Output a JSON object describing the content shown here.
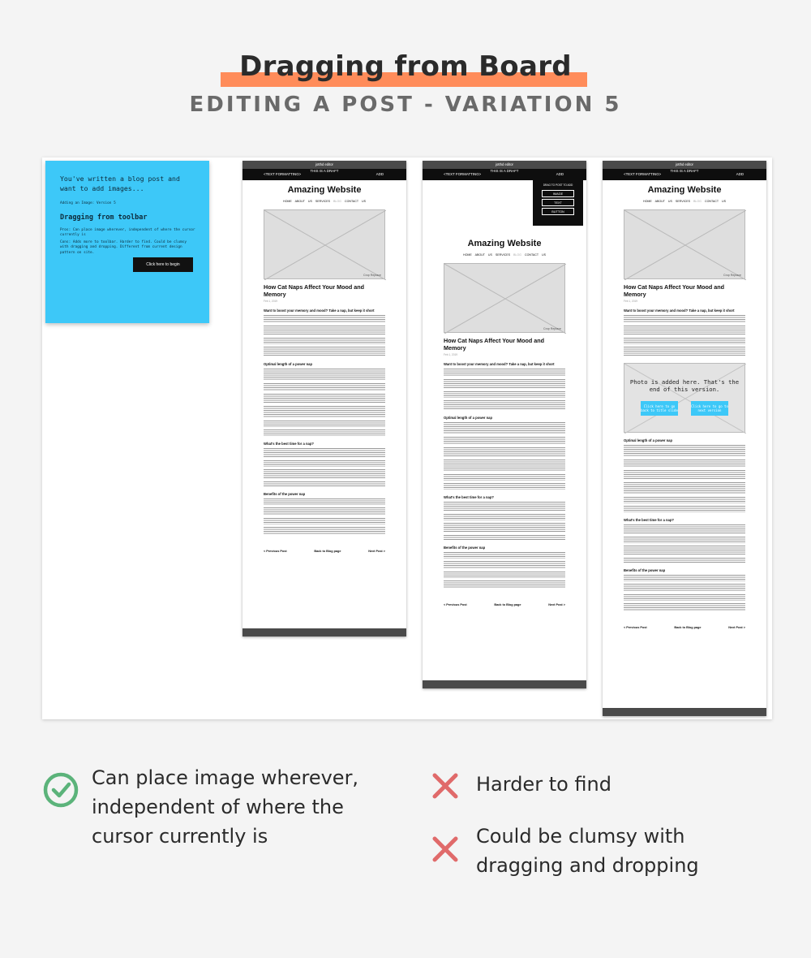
{
  "header": {
    "title": "Dragging from Board",
    "subtitle": "EDITING A POST - VARIATION 5"
  },
  "card": {
    "question": "You've written a blog post and want to add images...",
    "small_label": "Adding an Image: Version 5",
    "heading": "Dragging from toolbar",
    "pros_text": "Pros: Can place image wherever, independent of where the cursor currently is",
    "cons_text": "Cons: Adds more to toolbar. Harder to find. Could be clumsy with dragging and dropping. Different from current design pattern on site.",
    "button": "Click here to begin"
  },
  "editor": {
    "app_name": "jotthd editor",
    "draft_label": "THIS IS A DRAFT",
    "text_formatting": "<TEXT FORMATTING>",
    "add": "ADD",
    "site_title": "Amazing Website",
    "nav": [
      "HOME",
      "ABOUT US",
      "SERVICES",
      "BLOG",
      "CONTACT US"
    ],
    "image_caption": "Crop  Replace",
    "post_title": "How Cat Naps Affect Your Mood and Memory",
    "post_date": "Feb 1, 2019",
    "sections": [
      "Want to boost your memory and mood? Take a nap, but keep it short",
      "Optimal length of a power nap",
      "What's the best time for a nap?",
      "Benefits of the power nap"
    ],
    "footer_nav": [
      "< Previous Post",
      "Back to Blog page",
      "Next Post >"
    ]
  },
  "drag_menu": {
    "title": "DRAG TO POST TO ADD",
    "options": [
      "IMAGE",
      "TEXT",
      "BUTTON"
    ]
  },
  "photo_added": {
    "message": "Photo is added here. That's the end of this version.",
    "button_back": "Click here to go back to title slide",
    "button_next": "Click here to go to next version"
  },
  "pros": [
    "Can place image wherever, independent of where the cursor currently is"
  ],
  "cons": [
    "Harder to find",
    "Could be clumsy with dragging and dropping"
  ],
  "colors": {
    "highlight": "#ff8c5a",
    "card_blue": "#3dc8f8",
    "check_green": "#5bb37a",
    "cross_red": "#e06a6a"
  }
}
